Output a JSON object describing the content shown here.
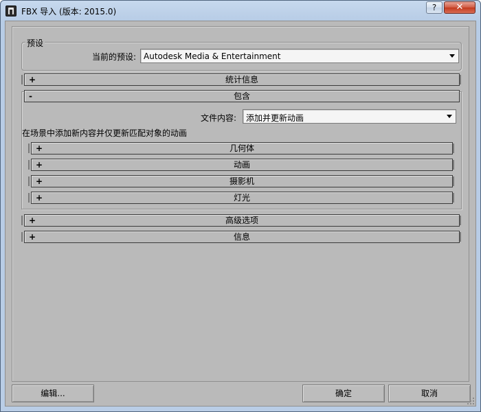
{
  "window": {
    "title": "FBX 导入 (版本: 2015.0)",
    "help_label": "?",
    "close_label": "✕"
  },
  "presets": {
    "group_label": "预设",
    "current_label": "当前的预设:",
    "current_value": "Autodesk Media & Entertainment"
  },
  "rollouts": {
    "statistics": {
      "sign": "+",
      "label": "统计信息"
    },
    "include": {
      "sign": "-",
      "label": "包含"
    },
    "advanced": {
      "sign": "+",
      "label": "高级选项"
    },
    "info": {
      "sign": "+",
      "label": "信息"
    }
  },
  "include": {
    "file_content_label": "文件内容:",
    "file_content_value": "添加并更新动画",
    "description": "在场景中添加新内容并仅更新匹配对象的动画",
    "sub_rollouts": [
      {
        "sign": "+",
        "label": "几何体"
      },
      {
        "sign": "+",
        "label": "动画"
      },
      {
        "sign": "+",
        "label": "摄影机"
      },
      {
        "sign": "+",
        "label": "灯光"
      }
    ]
  },
  "buttons": {
    "edit": "编辑...",
    "ok": "确定",
    "cancel": "取消"
  }
}
